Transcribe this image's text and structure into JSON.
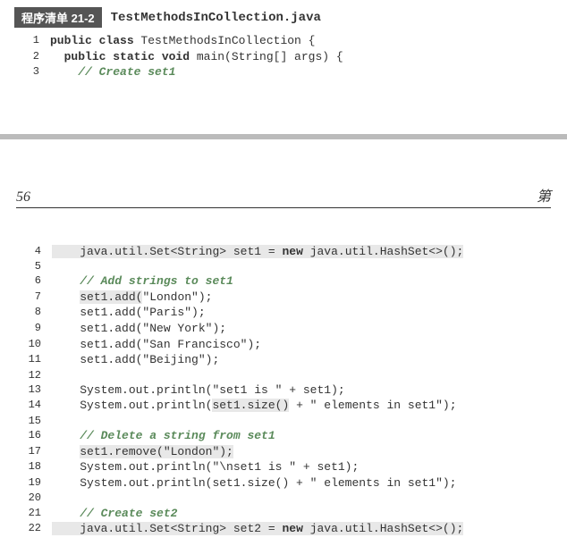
{
  "header": {
    "badge": "程序清单 21-2",
    "filename": "TestMethodsInCollection.java"
  },
  "page": {
    "number": "56",
    "right": "第"
  },
  "top_lines": [
    {
      "n": "1",
      "indent": "",
      "parts": [
        {
          "t": "public class ",
          "kw": true
        },
        {
          "t": "TestMethodsInCollection {"
        }
      ]
    },
    {
      "n": "2",
      "indent": "  ",
      "parts": [
        {
          "t": "public static void ",
          "kw": true
        },
        {
          "t": "main(String[] args) {"
        }
      ]
    },
    {
      "n": "3",
      "indent": "    ",
      "parts": [
        {
          "t": "// Create set1",
          "comment": true
        }
      ]
    }
  ],
  "bottom_lines": [
    {
      "n": "4",
      "indent": "    ",
      "hl": true,
      "parts": [
        {
          "t": "java.util.Set<String> set1 = "
        },
        {
          "t": "new ",
          "kw": true
        },
        {
          "t": "java.util.HashSet<>();"
        }
      ]
    },
    {
      "n": "5",
      "indent": "",
      "parts": []
    },
    {
      "n": "6",
      "indent": "    ",
      "parts": [
        {
          "t": "// Add strings to set1",
          "comment": true
        }
      ]
    },
    {
      "n": "7",
      "indent": "    ",
      "parts": [
        {
          "t": "set1.add(",
          "hl": true
        },
        {
          "t": "\"London\");"
        }
      ]
    },
    {
      "n": "8",
      "indent": "    ",
      "parts": [
        {
          "t": "set1.add(\"Paris\");"
        }
      ]
    },
    {
      "n": "9",
      "indent": "    ",
      "parts": [
        {
          "t": "set1.add(\"New York\");"
        }
      ]
    },
    {
      "n": "10",
      "indent": "    ",
      "parts": [
        {
          "t": "set1.add(\"San Francisco\");"
        }
      ]
    },
    {
      "n": "11",
      "indent": "    ",
      "parts": [
        {
          "t": "set1.add(\"Beijing\");"
        }
      ]
    },
    {
      "n": "12",
      "indent": "",
      "parts": []
    },
    {
      "n": "13",
      "indent": "    ",
      "parts": [
        {
          "t": "System.out.println(\"set1 is \" + set1);"
        }
      ]
    },
    {
      "n": "14",
      "indent": "    ",
      "parts": [
        {
          "t": "System.out.println("
        },
        {
          "t": "set1.size()",
          "hl": true
        },
        {
          "t": " + \" elements in set1\");"
        }
      ]
    },
    {
      "n": "15",
      "indent": "",
      "parts": []
    },
    {
      "n": "16",
      "indent": "    ",
      "parts": [
        {
          "t": "// Delete a string from set1",
          "comment": true
        }
      ]
    },
    {
      "n": "17",
      "indent": "    ",
      "parts": [
        {
          "t": "set1.remove(\"London\");",
          "hl": true
        }
      ]
    },
    {
      "n": "18",
      "indent": "    ",
      "parts": [
        {
          "t": "System.out.println(\"\\nset1 is \" + set1);"
        }
      ]
    },
    {
      "n": "19",
      "indent": "    ",
      "parts": [
        {
          "t": "System.out.println(set1.size() + \" elements in set1\");"
        }
      ]
    },
    {
      "n": "20",
      "indent": "",
      "parts": []
    },
    {
      "n": "21",
      "indent": "    ",
      "parts": [
        {
          "t": "// Create set2",
          "comment": true
        }
      ]
    },
    {
      "n": "22",
      "indent": "    ",
      "hl": true,
      "parts": [
        {
          "t": "java.util.Set<String> set2 = "
        },
        {
          "t": "new ",
          "kw": true
        },
        {
          "t": "java.util.HashSet<>();"
        }
      ]
    }
  ]
}
